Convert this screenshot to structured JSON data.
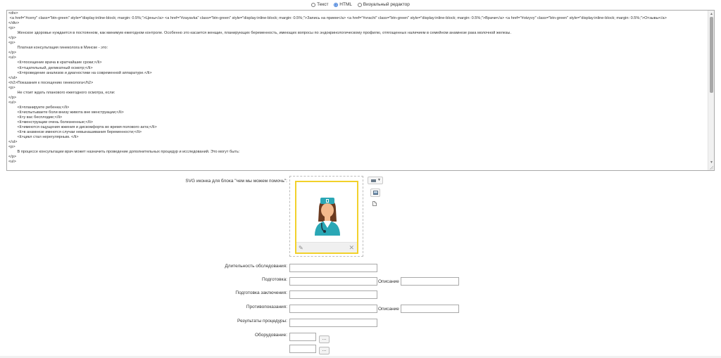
{
  "mode_switch": {
    "options": [
      {
        "label": "Текст",
        "checked": false
      },
      {
        "label": "HTML",
        "checked": true
      },
      {
        "label": "Визуальный редактор",
        "checked": false
      }
    ]
  },
  "editor": {
    "content": "<div>\n <a href=\"#ceny\" class=\"btn-green\" style=\"display:inline-block; margin: 0.5%;\">Цены</a> <a href=\"#zayavka\" class=\"btn-green\" style=\"display:inline-block; margin: 0.5%;\">Запись на прием</a> <a href=\"#vrachi\" class=\"btn-green\" style=\"display:inline-block; margin: 0.5%;\">Врачи</a> <a href=\"#otzyvy\" class=\"btn-green\" style=\"display:inline-block; margin: 0.5%;\">Отзывы</a>\n</div>\n<p>\n\tЖенское здоровье нуждается в постоянном, как минимум ежегодном контроле. Особенно это касается женщин, планирующих беременность, имеющих вопросы по эндокринологическому профилю, отягощенных наличием в семейном анамнезе рака молочной железы.\n</p>\n<p>\n\tПлатная консультация гинеколога в Минске - это:\n</p>\n<ul>\n\t<li>посещение врача в кратчайшие сроки;</li>\n\t<li>тщательный, деликатный осмотр;</li>\n\t<li>проведение анализов и диагностики на современной аппаратуре.</li>\n</ul>\n<h2>Показания к посещению гинеколога</h2>\n<p>\n\tНе стоит ждать планового ежегодного осмотра, если:\n</p>\n<ul>\n\t<li>планируете ребенка;</li>\n\t<li>испытываете боли внизу живота вне менструации;</li>\n\t<li>у вас бесплодие;</li>\n\t<li>менструации очень болезненные;</li>\n\t<li>имеются ощущения жжения и дискомфорта во время полового акта;</li>\n\t<li>в анамнезе имеются случаи невынашивания беременности;</li>\n\t<li>цикл стал нерегулярным. </li>\n</ul>\n<p>\n\tВ процессе консультации врач может назначить проведение дополнительных процедур и исследований. Это могут быть:\n</p>\n<ul>"
  },
  "svg_field": {
    "label": "SVG иконка для блока \"чем мы можем помочь\":",
    "icon": "doctor-woman-icon"
  },
  "fields": {
    "duration": {
      "label": "Длительность обследования:",
      "value": ""
    },
    "preparation": {
      "label": "Подготовка:",
      "value": "",
      "desc_label": "Описание",
      "desc_value": ""
    },
    "conclusion": {
      "label": "Подготовка заключения:",
      "value": ""
    },
    "contraindications": {
      "label": "Противопоказания:",
      "value": "",
      "desc_label": "Описание",
      "desc_value": ""
    },
    "results": {
      "label": "Результаты процедуры:",
      "value": ""
    },
    "equipment": {
      "label": "Оборудование:",
      "values": [
        "",
        ""
      ],
      "button_label": "..."
    }
  },
  "colors": {
    "preview_border": "#f2d12b",
    "nurse_teal": "#2aa7b5",
    "nurse_hair": "#6b3a1f",
    "nurse_skin": "#f3b98c"
  }
}
